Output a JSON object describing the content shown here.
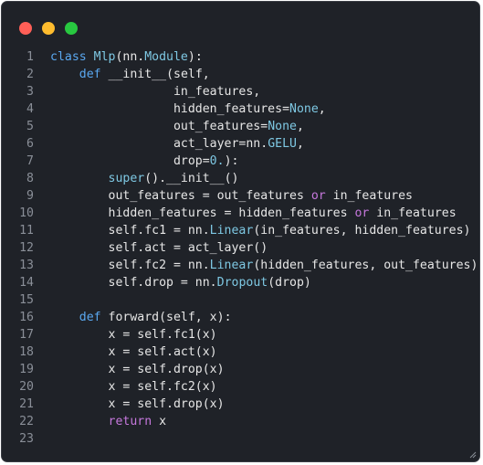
{
  "window": {
    "controls": [
      "close",
      "minimize",
      "maximize"
    ]
  },
  "code": {
    "lines": [
      {
        "n": "1",
        "tokens": [
          {
            "t": "class ",
            "c": "kw"
          },
          {
            "t": "Mlp",
            "c": "cls"
          },
          {
            "t": "(nn.",
            "c": "plain"
          },
          {
            "t": "Module",
            "c": "cls"
          },
          {
            "t": "):",
            "c": "plain"
          }
        ]
      },
      {
        "n": "2",
        "tokens": [
          {
            "t": "    ",
            "c": "plain"
          },
          {
            "t": "def ",
            "c": "kw"
          },
          {
            "t": "__init__",
            "c": "plain"
          },
          {
            "t": "(self,",
            "c": "plain"
          }
        ]
      },
      {
        "n": "3",
        "tokens": [
          {
            "t": "                 in_features,",
            "c": "plain"
          }
        ]
      },
      {
        "n": "4",
        "tokens": [
          {
            "t": "                 hidden_features=",
            "c": "plain"
          },
          {
            "t": "None",
            "c": "const"
          },
          {
            "t": ",",
            "c": "plain"
          }
        ]
      },
      {
        "n": "5",
        "tokens": [
          {
            "t": "                 out_features=",
            "c": "plain"
          },
          {
            "t": "None",
            "c": "const"
          },
          {
            "t": ",",
            "c": "plain"
          }
        ]
      },
      {
        "n": "6",
        "tokens": [
          {
            "t": "                 act_layer=nn.",
            "c": "plain"
          },
          {
            "t": "GELU",
            "c": "const"
          },
          {
            "t": ",",
            "c": "plain"
          }
        ]
      },
      {
        "n": "7",
        "tokens": [
          {
            "t": "                 drop=",
            "c": "plain"
          },
          {
            "t": "0.",
            "c": "num"
          },
          {
            "t": "):",
            "c": "plain"
          }
        ]
      },
      {
        "n": "8",
        "tokens": [
          {
            "t": "        ",
            "c": "plain"
          },
          {
            "t": "super",
            "c": "fn"
          },
          {
            "t": "().__init__()",
            "c": "plain"
          }
        ]
      },
      {
        "n": "9",
        "tokens": [
          {
            "t": "        out_features = out_features ",
            "c": "plain"
          },
          {
            "t": "or",
            "c": "op"
          },
          {
            "t": " in_features",
            "c": "plain"
          }
        ]
      },
      {
        "n": "10",
        "tokens": [
          {
            "t": "        hidden_features = hidden_features ",
            "c": "plain"
          },
          {
            "t": "or",
            "c": "op"
          },
          {
            "t": " in_features",
            "c": "plain"
          }
        ]
      },
      {
        "n": "11",
        "tokens": [
          {
            "t": "        self.fc1 = nn.",
            "c": "plain"
          },
          {
            "t": "Linear",
            "c": "fn"
          },
          {
            "t": "(in_features, hidden_features)",
            "c": "plain"
          }
        ]
      },
      {
        "n": "12",
        "tokens": [
          {
            "t": "        self.act = act_layer()",
            "c": "plain"
          }
        ]
      },
      {
        "n": "13",
        "tokens": [
          {
            "t": "        self.fc2 = nn.",
            "c": "plain"
          },
          {
            "t": "Linear",
            "c": "fn"
          },
          {
            "t": "(hidden_features, out_features)",
            "c": "plain"
          }
        ]
      },
      {
        "n": "14",
        "tokens": [
          {
            "t": "        self.drop = nn.",
            "c": "plain"
          },
          {
            "t": "Dropout",
            "c": "fn"
          },
          {
            "t": "(drop)",
            "c": "plain"
          }
        ]
      },
      {
        "n": "15",
        "tokens": []
      },
      {
        "n": "16",
        "tokens": [
          {
            "t": "    ",
            "c": "plain"
          },
          {
            "t": "def ",
            "c": "kw"
          },
          {
            "t": "forward",
            "c": "plain"
          },
          {
            "t": "(self, x):",
            "c": "plain"
          }
        ]
      },
      {
        "n": "17",
        "tokens": [
          {
            "t": "        x = self.fc1(x)",
            "c": "plain"
          }
        ]
      },
      {
        "n": "18",
        "tokens": [
          {
            "t": "        x = self.act(x)",
            "c": "plain"
          }
        ]
      },
      {
        "n": "19",
        "tokens": [
          {
            "t": "        x = self.drop(x)",
            "c": "plain"
          }
        ]
      },
      {
        "n": "20",
        "tokens": [
          {
            "t": "        x = self.fc2(x)",
            "c": "plain"
          }
        ]
      },
      {
        "n": "21",
        "tokens": [
          {
            "t": "        x = self.drop(x)",
            "c": "plain"
          }
        ]
      },
      {
        "n": "22",
        "tokens": [
          {
            "t": "        ",
            "c": "plain"
          },
          {
            "t": "return",
            "c": "ret"
          },
          {
            "t": " x",
            "c": "plain"
          }
        ]
      },
      {
        "n": "23",
        "tokens": []
      }
    ]
  },
  "colors": {
    "background": "#1f2228",
    "keyword": "#5aa8f0",
    "builtin": "#7ec8e3",
    "operator": "#c678dd",
    "text": "#e6e6e6",
    "line_number": "#8a8f98",
    "close": "#ff5f57",
    "minimize": "#febc2e",
    "maximize": "#28c840"
  }
}
